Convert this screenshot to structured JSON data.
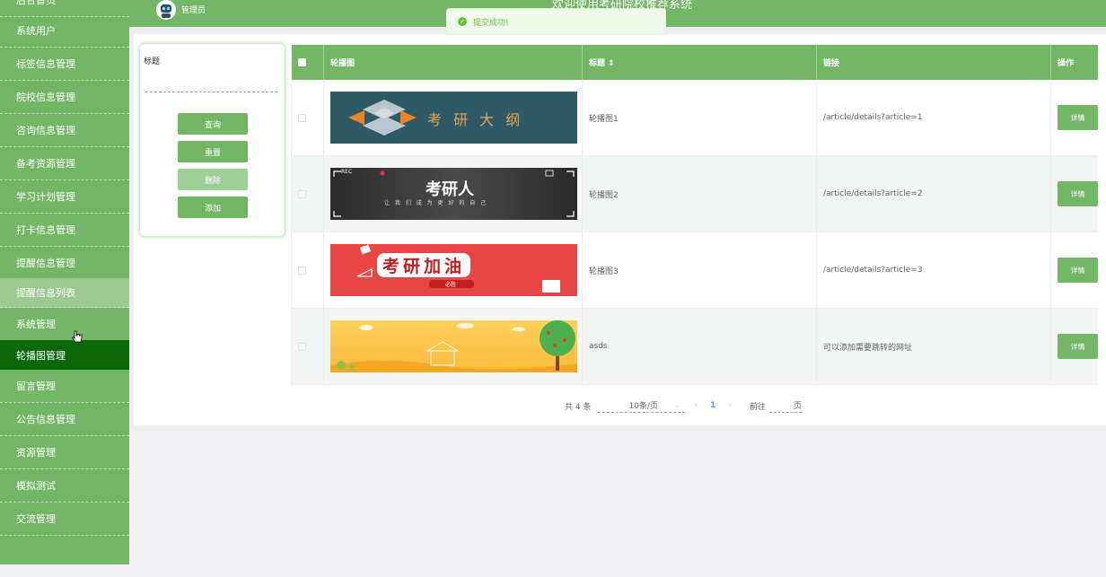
{
  "header": {
    "system_title": "欢迎使用考研院校推荐系统",
    "user_role": "管理员",
    "toast_message": "提交成功!"
  },
  "sidebar": {
    "items": [
      {
        "label": "后台首页"
      },
      {
        "label": "系统用户"
      },
      {
        "label": "标签信息管理"
      },
      {
        "label": "院校信息管理"
      },
      {
        "label": "咨询信息管理"
      },
      {
        "label": "备考资源管理"
      },
      {
        "label": "学习计划管理"
      },
      {
        "label": "打卡信息管理"
      },
      {
        "label": "提醒信息管理"
      },
      {
        "label": "提醒信息列表"
      },
      {
        "label": "系统管理"
      },
      {
        "label": "轮播图管理"
      },
      {
        "label": "留言管理"
      },
      {
        "label": "公告信息管理"
      },
      {
        "label": "资源管理"
      },
      {
        "label": "模拟测试"
      },
      {
        "label": "交流管理"
      }
    ]
  },
  "search": {
    "title_label": "标题",
    "query_button": "查询",
    "reset_button": "重置",
    "delete_button": "删除",
    "add_button": "添加"
  },
  "table": {
    "columns": {
      "image": "轮播图",
      "title": "标题 ⇕",
      "link": "链接",
      "action": "操作"
    },
    "rows": [
      {
        "title": "轮播图1",
        "link": "/article/details?article=1",
        "action": "详情",
        "banner_text": "考 研 大 纲"
      },
      {
        "title": "轮播图2",
        "link": "/article/details?article=2",
        "action": "详情",
        "banner_text": "考研人",
        "banner_subtext": "让 我 们 成 为 更 好 的 自 己",
        "banner_rec": "REC"
      },
      {
        "title": "轮播图3",
        "link": "/article/details?article=3",
        "action": "详情",
        "banner_text": "考研加油",
        "banner_subtext": "必胜"
      },
      {
        "title": "asds",
        "link": "可以添加需要跳转的网址",
        "action": "详情"
      }
    ]
  },
  "pagination": {
    "total": "共 4 条",
    "page_size": "10条/页",
    "current_page": "1",
    "goto_label": "前往",
    "page_unit": "页"
  }
}
